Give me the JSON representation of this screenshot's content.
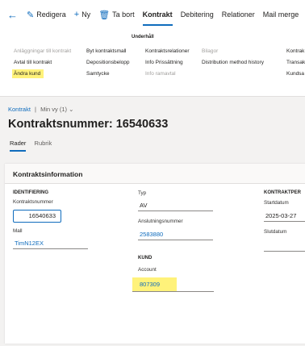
{
  "toolbar": {
    "edit_label": "Redigera",
    "new_label": "Ny",
    "delete_label": "Ta bort",
    "tabs": [
      "Kontrakt",
      "Debitering",
      "Relationer",
      "Mail merge",
      "A"
    ]
  },
  "ribbon": {
    "group_title": "Underhåll",
    "col1": [
      "Anläggningar till kontrakt",
      "Avtal till kontrakt",
      "Ändra kund"
    ],
    "col2": [
      "Byt kontraktsmall",
      "Depositionsbelopp",
      "Samtycke"
    ],
    "col3": [
      "Kontraktsrelationer",
      "Info Prissättning",
      "Info ramavtal"
    ],
    "col4": [
      "Bilagor",
      "Distribution method history"
    ],
    "col5": [
      "Kontrak",
      "Transak",
      "Kundsa"
    ]
  },
  "breadcrumb": {
    "root": "Kontrakt",
    "separator": "|",
    "view": "Min vy (1)"
  },
  "page_title": "Kontraktsnummer: 16540633",
  "subtabs": [
    "Rader",
    "Rubrik"
  ],
  "card": {
    "title": "Kontraktsinformation",
    "identification": {
      "section": "IDENTIFIERING",
      "number_label": "Kontraktsnummer",
      "number_value": "16540633",
      "template_label": "Mall",
      "template_value": "TimN12EX"
    },
    "type": {
      "type_label": "Typ",
      "type_value": "AV",
      "connection_label": "Anslutningsnummer",
      "connection_value": "2583880"
    },
    "customer": {
      "section": "KUND",
      "account_label": "Account",
      "account_value": "807309"
    },
    "period": {
      "section": "KONTRAKTPER",
      "start_label": "Startdatum",
      "start_value": "2025-03-27",
      "end_label": "Slutdatum",
      "end_value": ""
    }
  },
  "colors": {
    "accent": "#0f6cbd",
    "highlight": "#fff27a"
  },
  "icons": [
    "back-arrow-icon",
    "pencil-icon",
    "plus-icon",
    "trash-icon",
    "chevron-down-icon"
  ]
}
